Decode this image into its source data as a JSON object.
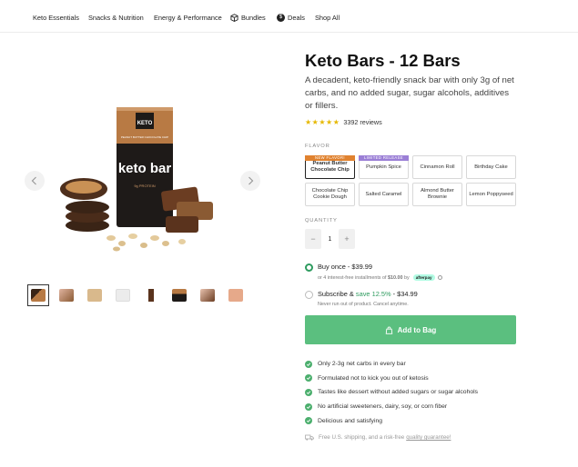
{
  "nav": {
    "items": [
      "Keto Essentials",
      "Snacks & Nutrition",
      "Energy & Performance",
      "Bundles",
      "Deals",
      "Shop All"
    ],
    "icons": [
      "box-icon",
      "dollar-icon"
    ]
  },
  "gallery": {
    "product_wrapper_brand": "KETO",
    "product_wrapper_name": "keto bar",
    "product_wrapper_flavor": "PEANUT BUTTER CHOCOLATE CHIP",
    "product_wrapper_protein": "9g PROTEIN",
    "thumbnail_count": 9,
    "active_thumbnail": 1
  },
  "product": {
    "title": "Keto Bars - 12 Bars",
    "description": "A decadent, keto-friendly snack bar with only 3g of net carbs, and no added sugar, sugar alcohols, additives or fillers.",
    "rating": 4.5,
    "review_count": "3392 reviews"
  },
  "flavor": {
    "label": "FLAVOR",
    "options": [
      {
        "name": "Peanut Butter Chocolate Chip",
        "selected": true,
        "tag": "NEW FLAVOR!",
        "tag_color": "#e0822f"
      },
      {
        "name": "Pumpkin Spice",
        "selected": false,
        "tag": "LIMITED RELEASE",
        "tag_color": "#9b7fd6"
      },
      {
        "name": "Cinnamon Roll",
        "selected": false,
        "tag": "",
        "tag_color": ""
      },
      {
        "name": "Birthday Cake",
        "selected": false,
        "tag": "",
        "tag_color": ""
      },
      {
        "name": "Chocolate Chip Cookie Dough",
        "selected": false,
        "tag": "",
        "tag_color": ""
      },
      {
        "name": "Salted Caramel",
        "selected": false,
        "tag": "",
        "tag_color": ""
      },
      {
        "name": "Almond Butter Brownie",
        "selected": false,
        "tag": "",
        "tag_color": ""
      },
      {
        "name": "Lemon Poppyseed",
        "selected": false,
        "tag": "",
        "tag_color": ""
      }
    ]
  },
  "quantity": {
    "label": "QUANTITY",
    "value": "1",
    "minus": "−",
    "plus": "+"
  },
  "purchase": {
    "once_label": "Buy once - $39.99",
    "once_sub": "or 4 interest-free installments of",
    "once_amount": "$10.00",
    "once_by": "by",
    "afterpay": "afterpay",
    "subscribe_prefix": "Subscribe &",
    "subscribe_save": "save 12.5%",
    "subscribe_price": "- $34.99",
    "subscribe_sub": "Never run out of product. Cancel anytime."
  },
  "cta": {
    "add_to_bag": "Add to Bag"
  },
  "benefits": [
    "Only 2-3g net carbs in every bar",
    "Formulated not to kick you out of ketosis",
    "Tastes like dessert without added sugars or sugar alcohols",
    "No artificial sweeteners, dairy, soy, or corn fiber",
    "Delicious and satisfying"
  ],
  "shipping": {
    "text": "Free U.S. shipping, and a risk-free",
    "link": "quality guarantee!"
  },
  "colors": {
    "accent_green": "#5bbf7f",
    "check_green": "#4caf6e",
    "radio_green": "#2e9b5f",
    "star": "#e6b800"
  }
}
